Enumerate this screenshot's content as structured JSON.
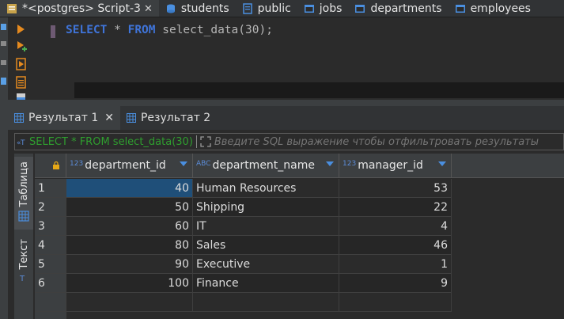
{
  "editor_tabs": [
    {
      "label": "*<postgres> Script-3",
      "icon": "sql-script-icon",
      "active": true
    },
    {
      "label": "students",
      "icon": "database-icon",
      "active": false
    },
    {
      "label": "public",
      "icon": "schema-icon",
      "active": false
    },
    {
      "label": "jobs",
      "icon": "table-icon",
      "active": false
    },
    {
      "label": "departments",
      "icon": "table-icon",
      "active": false
    },
    {
      "label": "employees",
      "icon": "table-icon",
      "active": false
    }
  ],
  "editor": {
    "code_keyword1": "SELECT",
    "code_mid": " * ",
    "code_keyword2": "FROM",
    "code_rest": " select_data(30);"
  },
  "result_tabs": [
    {
      "label": "Результат 1",
      "active": true
    },
    {
      "label": "Результат 2",
      "active": false
    }
  ],
  "filter": {
    "sql": "SELECT * FROM select_data(30)",
    "placeholder": "Введите SQL выражение чтобы отфильтровать результаты"
  },
  "side_tabs": [
    {
      "label": "Таблица",
      "active": true
    },
    {
      "label": "Текст",
      "active": false
    }
  ],
  "columns": [
    {
      "type": "123",
      "name": "department_id"
    },
    {
      "type": "ABC",
      "name": "department_name"
    },
    {
      "type": "123",
      "name": "manager_id"
    }
  ],
  "rows": [
    {
      "n": "1",
      "department_id": "40",
      "department_name": "Human Resources",
      "manager_id": "53"
    },
    {
      "n": "2",
      "department_id": "50",
      "department_name": "Shipping",
      "manager_id": "22"
    },
    {
      "n": "3",
      "department_id": "60",
      "department_name": "IT",
      "manager_id": "4"
    },
    {
      "n": "4",
      "department_id": "80",
      "department_name": "Sales",
      "manager_id": "46"
    },
    {
      "n": "5",
      "department_id": "90",
      "department_name": "Executive",
      "manager_id": "1"
    },
    {
      "n": "6",
      "department_id": "100",
      "department_name": "Finance",
      "manager_id": "9"
    }
  ],
  "colors": {
    "keyword": "#3f74d9",
    "selection": "#1f4f79",
    "filter_sql": "#2f9e2f"
  }
}
